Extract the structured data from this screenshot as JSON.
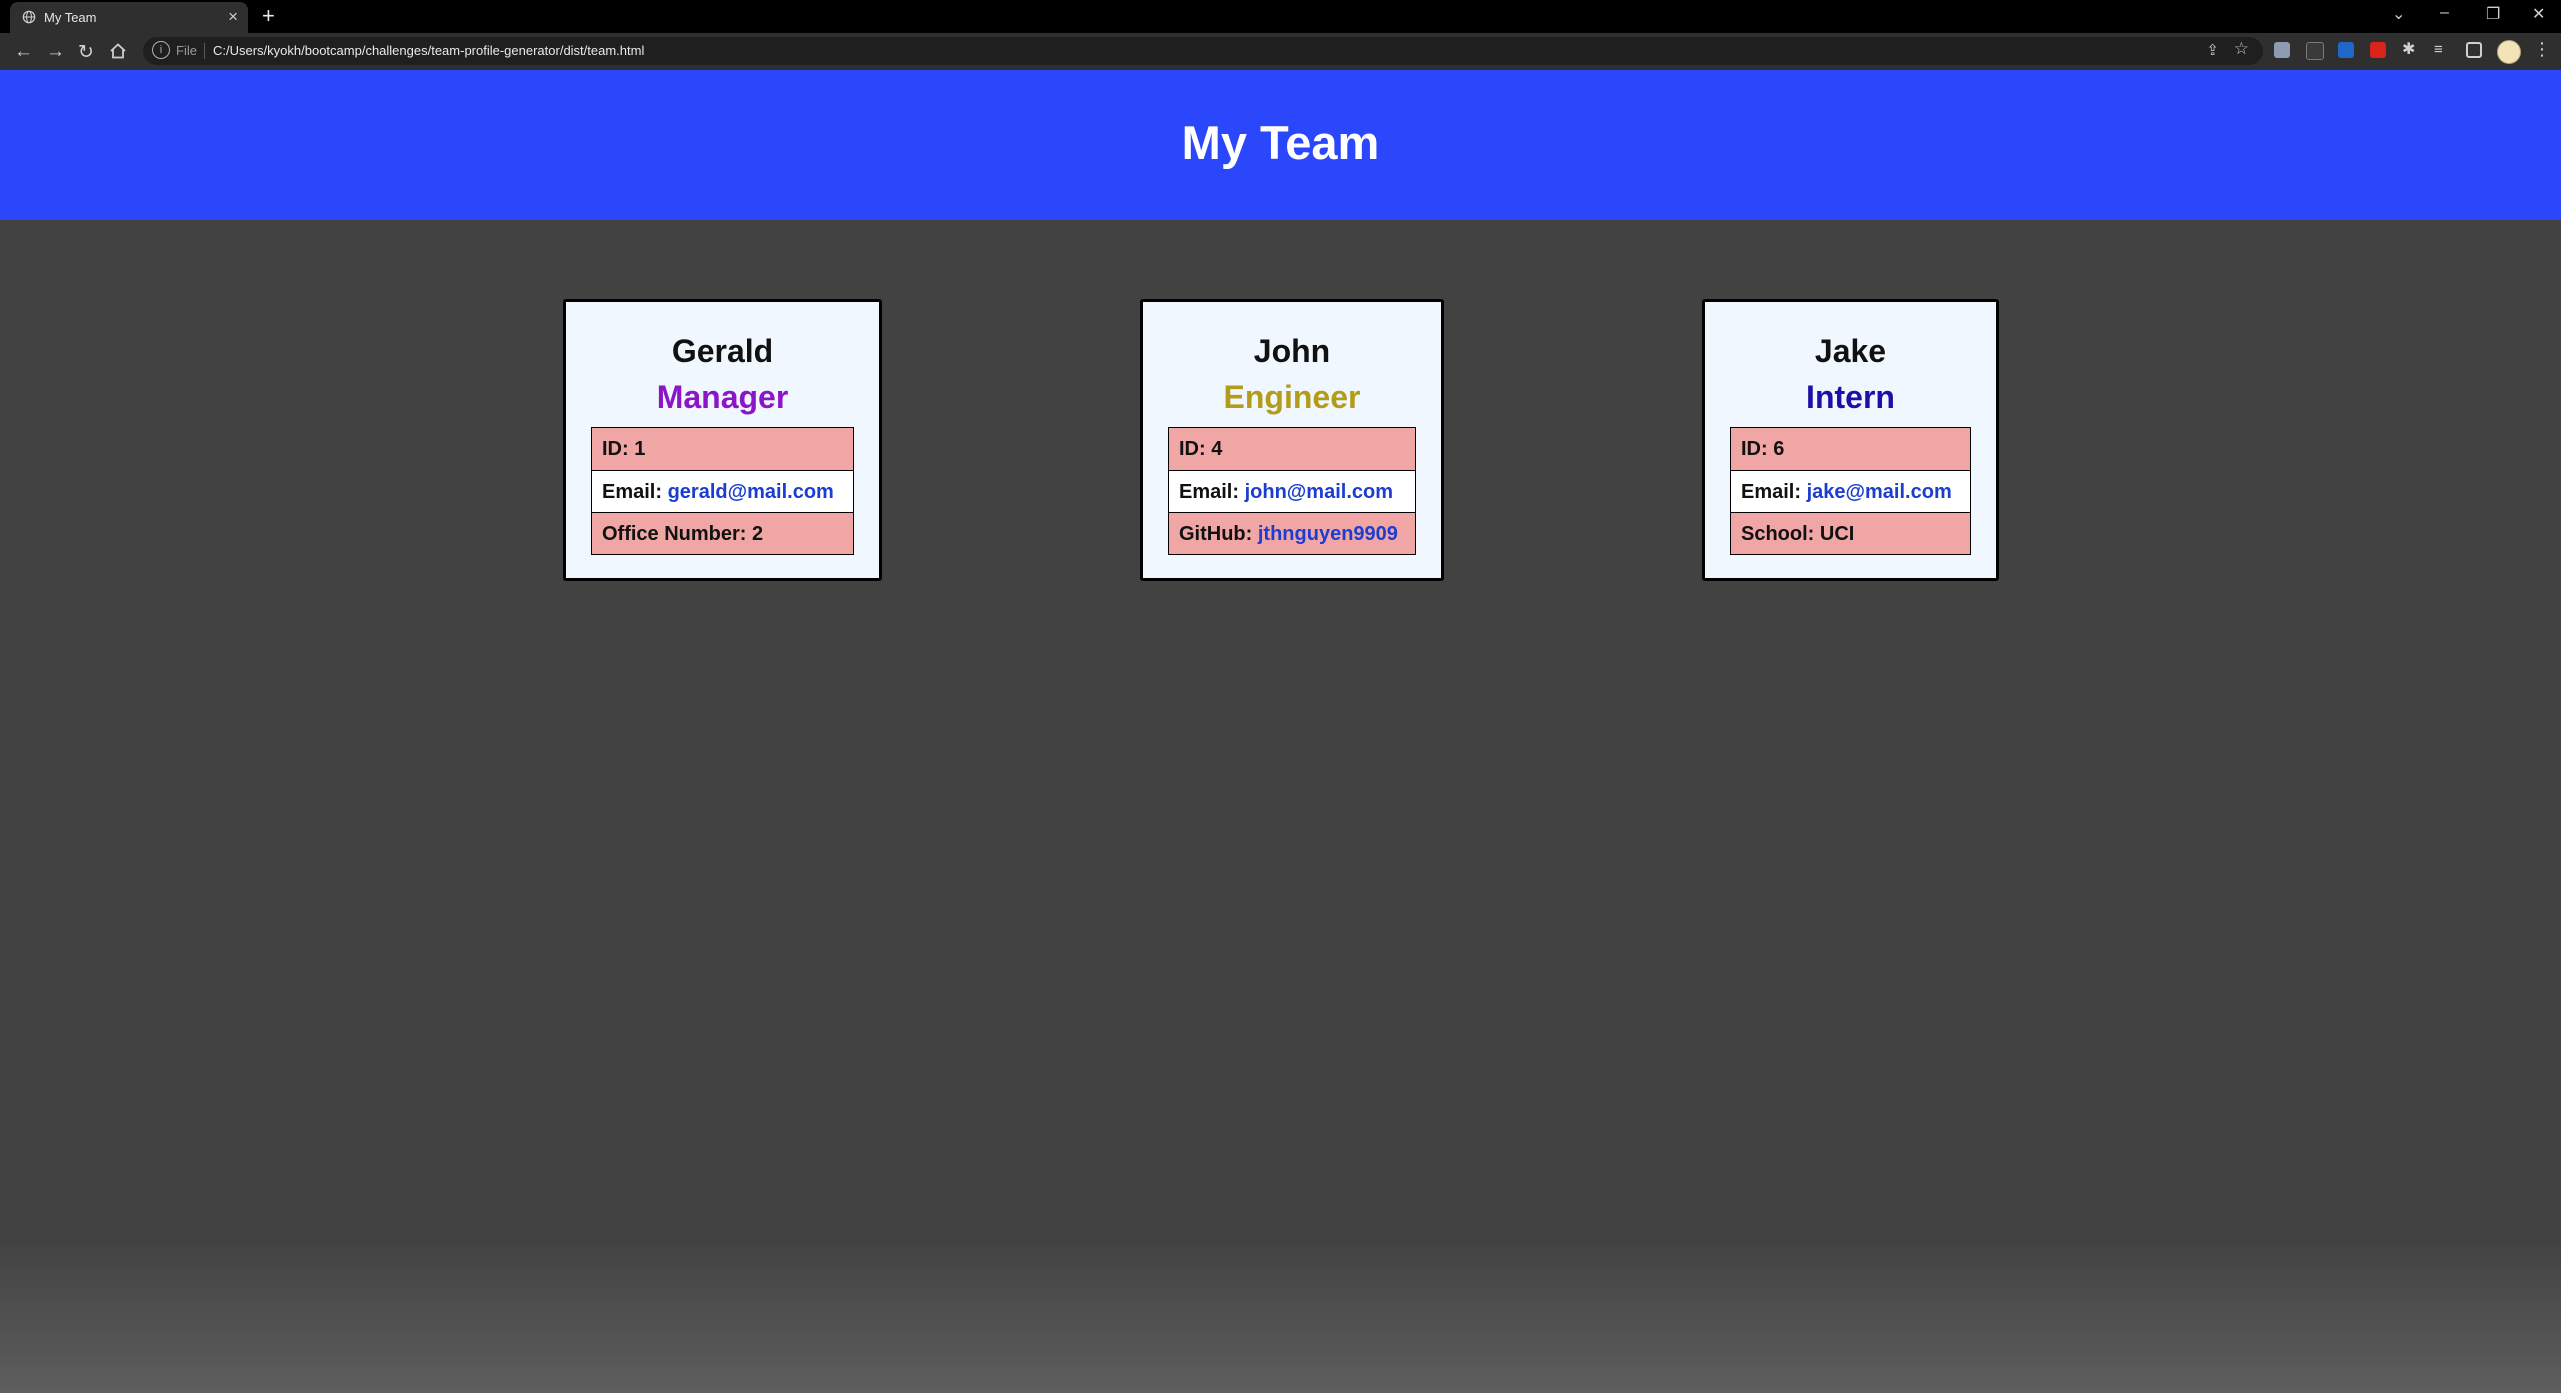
{
  "browser": {
    "tab_title": "My Team",
    "url_scheme": "File",
    "url": "C:/Users/kyokh/bootcamp/challenges/team-profile-generator/dist/team.html"
  },
  "page": {
    "heading": "My Team"
  },
  "team": [
    {
      "name": "Gerald",
      "role": "Manager",
      "id_label": "ID:",
      "id": "1",
      "email_label": "Email:",
      "email": "gerald@mail.com",
      "extra_label": "Office Number:",
      "extra": "2"
    },
    {
      "name": "John",
      "role": "Engineer",
      "id_label": "ID:",
      "id": "4",
      "email_label": "Email:",
      "email": "john@mail.com",
      "extra_label": "GitHub:",
      "extra": "jthnguyen9909"
    },
    {
      "name": "Jake",
      "role": "Intern",
      "id_label": "ID:",
      "id": "6",
      "email_label": "Email:",
      "email": "jake@mail.com",
      "extra_label": "School:",
      "extra": "UCI"
    }
  ],
  "colors": {
    "header_bg": "#2b47fb",
    "page_bg": "#424242",
    "card_bg": "#f0f7ff",
    "row_pink": "#f1a6a6",
    "link": "#1b3dd1",
    "manager": "#8b15c7",
    "engineer": "#b39c18",
    "intern": "#1b10a8"
  }
}
